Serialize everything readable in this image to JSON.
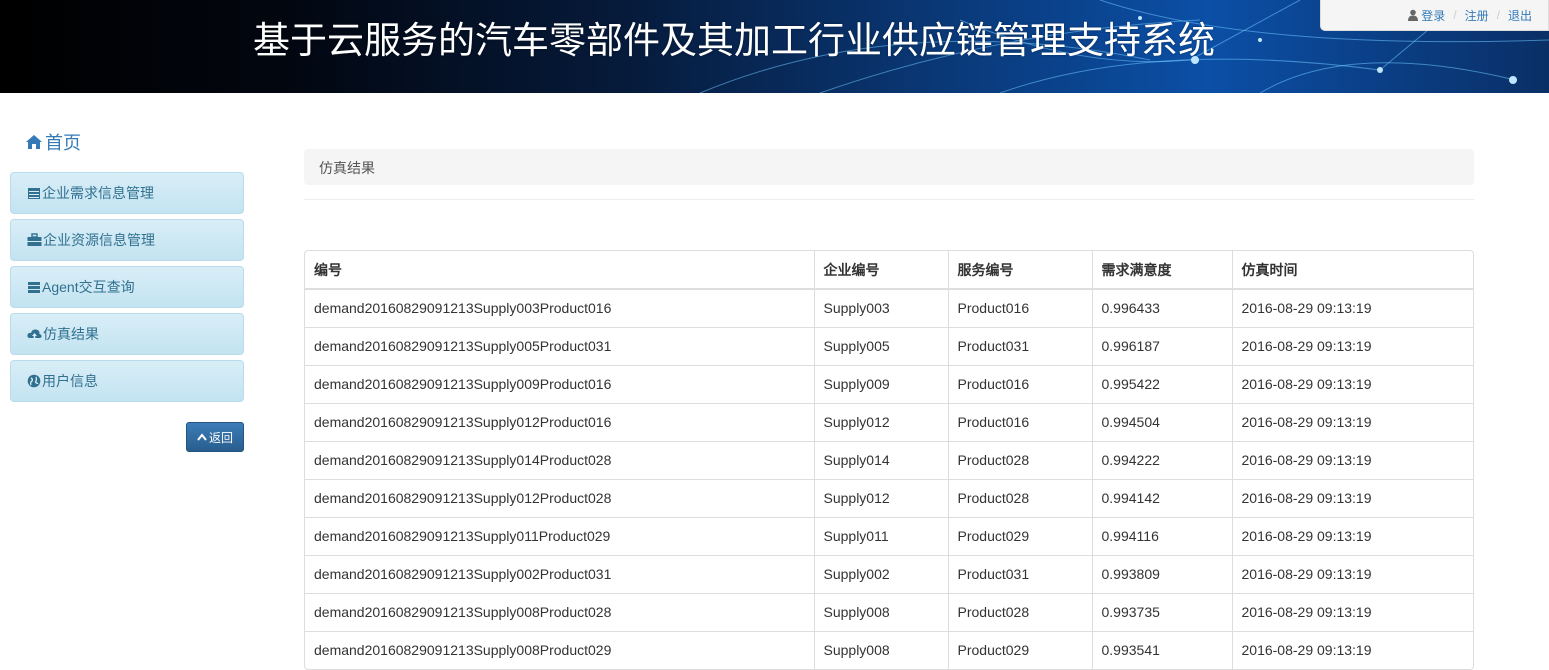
{
  "header": {
    "title": "基于云服务的汽车零部件及其加工行业供应链管理支持系统",
    "nav": {
      "login": "登录",
      "register": "注册",
      "logout": "退出"
    }
  },
  "sidebar": {
    "home": "首页",
    "items": [
      {
        "label": "企业需求信息管理",
        "icon": "calendar-icon"
      },
      {
        "label": "企业资源信息管理",
        "icon": "briefcase-icon"
      },
      {
        "label": "Agent交互查询",
        "icon": "list-icon"
      },
      {
        "label": "仿真结果",
        "icon": "cloud-upload-icon"
      },
      {
        "label": "用户信息",
        "icon": "globe-icon"
      }
    ],
    "back_label": "返回"
  },
  "breadcrumb": "仿真结果",
  "table": {
    "headers": [
      "编号",
      "企业编号",
      "服务编号",
      "需求满意度",
      "仿真时间"
    ],
    "rows": [
      [
        "demand20160829091213Supply003Product016",
        "Supply003",
        "Product016",
        "0.996433",
        "2016-08-29 09:13:19"
      ],
      [
        "demand20160829091213Supply005Product031",
        "Supply005",
        "Product031",
        "0.996187",
        "2016-08-29 09:13:19"
      ],
      [
        "demand20160829091213Supply009Product016",
        "Supply009",
        "Product016",
        "0.995422",
        "2016-08-29 09:13:19"
      ],
      [
        "demand20160829091213Supply012Product016",
        "Supply012",
        "Product016",
        "0.994504",
        "2016-08-29 09:13:19"
      ],
      [
        "demand20160829091213Supply014Product028",
        "Supply014",
        "Product028",
        "0.994222",
        "2016-08-29 09:13:19"
      ],
      [
        "demand20160829091213Supply012Product028",
        "Supply012",
        "Product028",
        "0.994142",
        "2016-08-29 09:13:19"
      ],
      [
        "demand20160829091213Supply011Product029",
        "Supply011",
        "Product029",
        "0.994116",
        "2016-08-29 09:13:19"
      ],
      [
        "demand20160829091213Supply002Product031",
        "Supply002",
        "Product031",
        "0.993809",
        "2016-08-29 09:13:19"
      ],
      [
        "demand20160829091213Supply008Product028",
        "Supply008",
        "Product028",
        "0.993735",
        "2016-08-29 09:13:19"
      ],
      [
        "demand20160829091213Supply008Product029",
        "Supply008",
        "Product029",
        "0.993541",
        "2016-08-29 09:13:19"
      ]
    ]
  },
  "colors": {
    "link": "#337ab7",
    "sidebar_bg": "#c3e3f1",
    "back_button": "#285e8e"
  }
}
